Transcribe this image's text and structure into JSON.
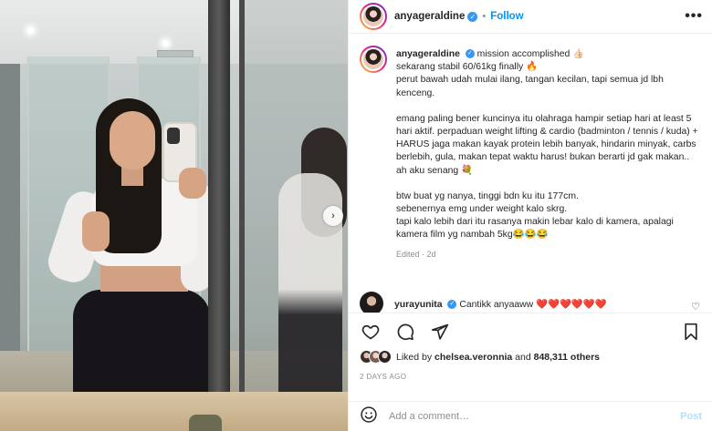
{
  "post": {
    "username": "anyageraldine",
    "verified_icon": "verified-badge-icon",
    "separator": "•",
    "follow_label": "Follow",
    "more_label": "•••"
  },
  "caption": {
    "username": "anyageraldine",
    "first_line": "mission accomplished 👍🏻",
    "paragraphs": [
      "sekarang stabil 60/61kg finally 🔥\nperut bawah udah mulai ilang, tangan kecilan, tapi semua jd lbh kenceng.",
      "emang paling bener kuncinya itu olahraga hampir setiap hari at least 5 hari aktif. perpaduan weight lifting & cardio (badminton / tennis / kuda) + HARUS jaga makan kayak protein lebih banyak, hindarin minyak, carbs berlebih, gula, makan tepat waktu harus! bukan berarti jd gak makan.. ah aku senang 💐",
      "btw buat yg nanya, tinggi bdn ku itu 177cm.\nsebenernya emg under weight kalo skrg.\ntapi kalo lebih dari itu rasanya makin lebar kalo di kamera, apalagi kamera film yg nambah 5kg😂😂😂"
    ],
    "edited": "Edited · 2d"
  },
  "top_comment": {
    "username": "yurayunita",
    "text": "Cantikk anyaaww ❤️❤️❤️❤️❤️❤️"
  },
  "likes": {
    "prefix": "Liked by",
    "user": "chelsea.veronnia",
    "connector": "and",
    "count": "848,311 others"
  },
  "timestamp": "2 DAYS AGO",
  "add_comment": {
    "placeholder": "Add a comment…",
    "post_label": "Post"
  },
  "colors": {
    "accent": "#0095f6",
    "verified": "#3897f0",
    "muted": "#8e8e8e",
    "post_disabled": "#b2dffc"
  }
}
